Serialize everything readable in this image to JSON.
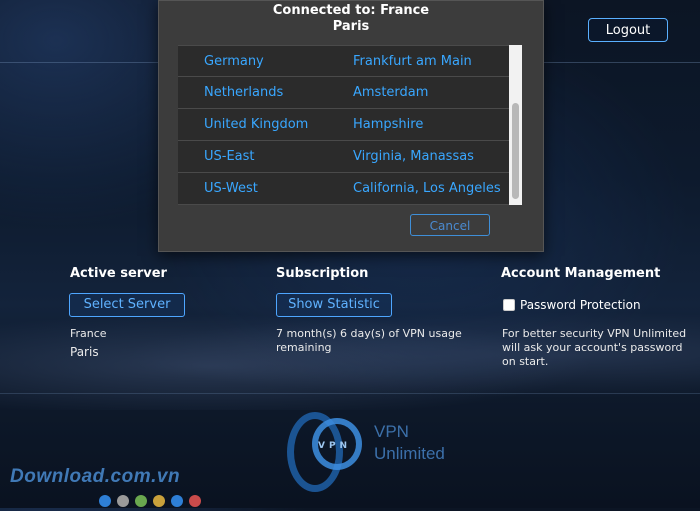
{
  "header": {
    "logout_label": "Logout"
  },
  "dialog": {
    "title_line1": "Connected to: France",
    "title_line2": "Paris",
    "servers": [
      {
        "country": "Germany",
        "city": "Frankfurt am Main"
      },
      {
        "country": "Netherlands",
        "city": "Amsterdam"
      },
      {
        "country": "United Kingdom",
        "city": "Hampshire"
      },
      {
        "country": "US-East",
        "city": "Virginia, Manassas"
      },
      {
        "country": "US-West",
        "city": "California, Los Angeles"
      }
    ],
    "cancel_label": "Cancel"
  },
  "active_server": {
    "heading": "Active server",
    "button_label": "Select Server",
    "country": "France",
    "city": "Paris"
  },
  "subscription": {
    "heading": "Subscription",
    "button_label": "Show Statistic",
    "remaining_line1": "7 month(s) 6 day(s) of VPN usage",
    "remaining_line2": "remaining"
  },
  "account": {
    "heading": "Account Management",
    "checkbox_label": "Password Protection",
    "desc_line1": "For better security VPN Unlimited",
    "desc_line2": "will ask your account's password",
    "desc_line3": "on start."
  },
  "logo": {
    "mark": "VPN",
    "line1": "VPN",
    "line2": "Unlimited"
  },
  "watermark": {
    "text": "Download.com.vn",
    "dot_colors": [
      "#2e7fd6",
      "#9a9a9a",
      "#6aa84f",
      "#c9a13b",
      "#2e7fd6",
      "#c94b4b"
    ]
  },
  "colors": {
    "accent": "#39a7ff",
    "button_border": "#4ea6ff"
  }
}
